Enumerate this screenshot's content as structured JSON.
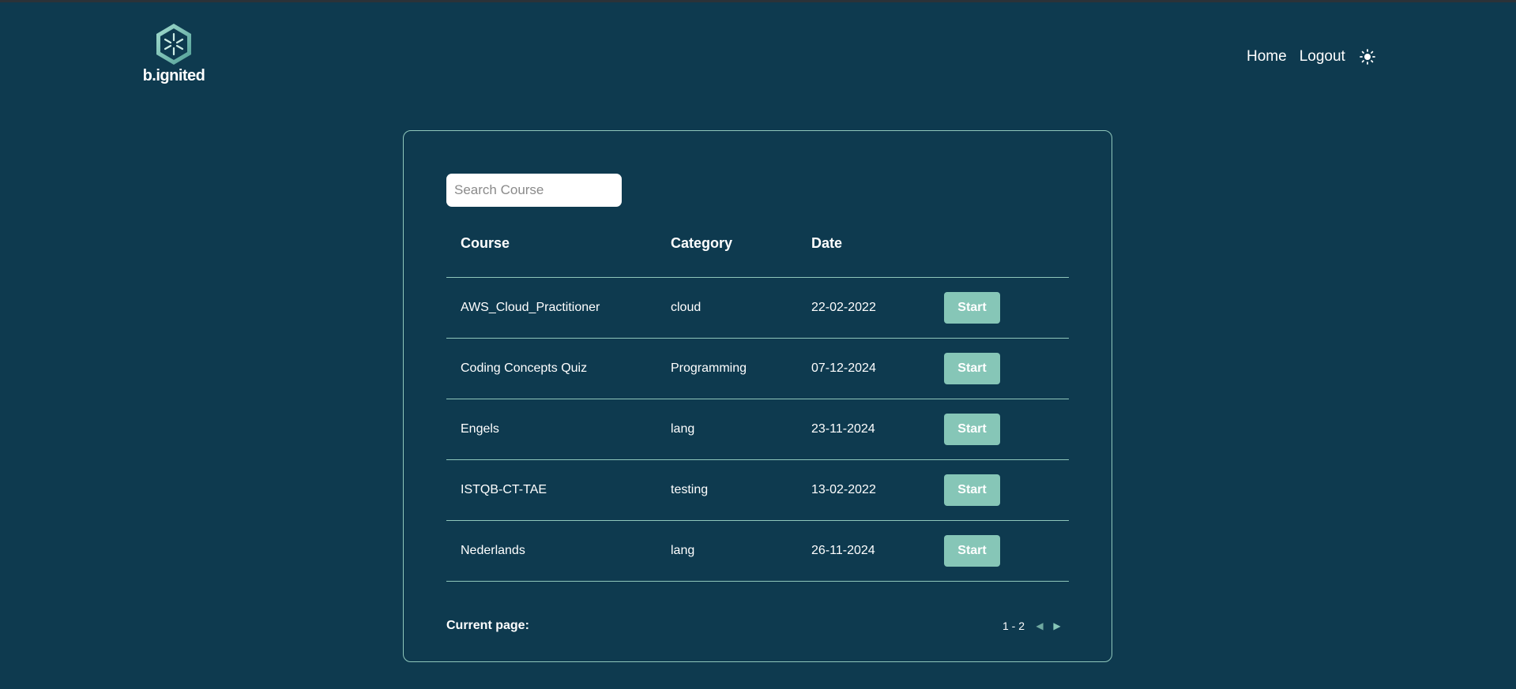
{
  "brand": {
    "name": "b.ignited"
  },
  "nav": {
    "home": "Home",
    "logout": "Logout",
    "theme_icon": "sun-icon"
  },
  "search": {
    "placeholder": "Search Course",
    "value": ""
  },
  "table": {
    "headers": {
      "course": "Course",
      "category": "Category",
      "date": "Date"
    },
    "rows": [
      {
        "course": "AWS_Cloud_Practitioner",
        "category": "cloud",
        "date": "22-02-2022",
        "action": "Start"
      },
      {
        "course": "Coding Concepts Quiz",
        "category": "Programming",
        "date": "07-12-2024",
        "action": "Start"
      },
      {
        "course": "Engels",
        "category": "lang",
        "date": "23-11-2024",
        "action": "Start"
      },
      {
        "course": "ISTQB-CT-TAE",
        "category": "testing",
        "date": "13-02-2022",
        "action": "Start"
      },
      {
        "course": "Nederlands",
        "category": "lang",
        "date": "26-11-2024",
        "action": "Start"
      }
    ]
  },
  "pagination": {
    "label": "Current page:",
    "range": "1 - 2",
    "prev_icon": "chevron-left-icon",
    "next_icon": "chevron-right-icon"
  },
  "colors": {
    "background": "#0e3a4f",
    "accent": "#86c6b7",
    "border": "#8fc7bb"
  }
}
